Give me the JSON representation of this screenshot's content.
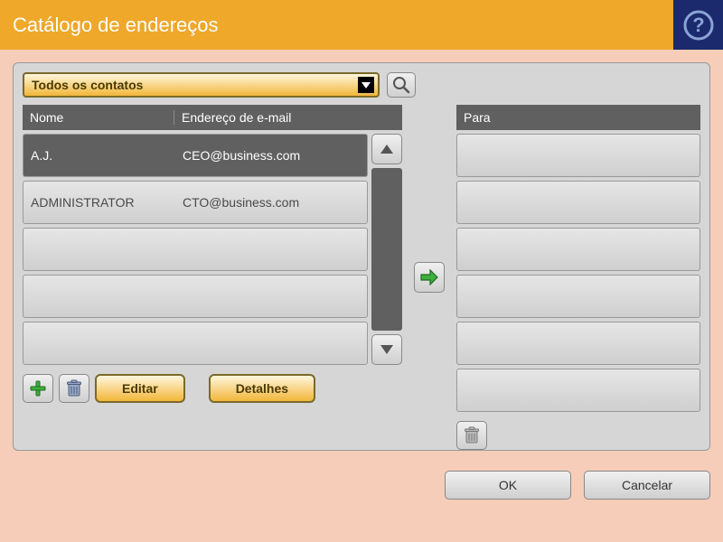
{
  "title": "Catálogo de endereços",
  "filter": {
    "selected": "Todos os contatos"
  },
  "list": {
    "headers": {
      "name": "Nome",
      "email": "Endereço de e-mail"
    },
    "rows": [
      {
        "name": "A.J.",
        "email": "CEO@business.com",
        "selected": true
      },
      {
        "name": "ADMINISTRATOR",
        "email": "CTO@business.com",
        "selected": false
      }
    ]
  },
  "recipients": {
    "header": "Para"
  },
  "buttons": {
    "edit": "Editar",
    "details": "Detalhes",
    "ok": "OK",
    "cancel": "Cancelar"
  },
  "icons": {
    "help": "help-icon",
    "search": "search-icon",
    "add": "plus-icon",
    "trash": "trash-icon",
    "move_right": "arrow-right-icon",
    "scroll_up": "chevron-up-icon",
    "scroll_down": "chevron-down-icon"
  },
  "colors": {
    "accent": "#efa82a",
    "panel_bg": "#f5cdb8",
    "header_gray": "#606060",
    "help_bg": "#1a2a6c"
  }
}
